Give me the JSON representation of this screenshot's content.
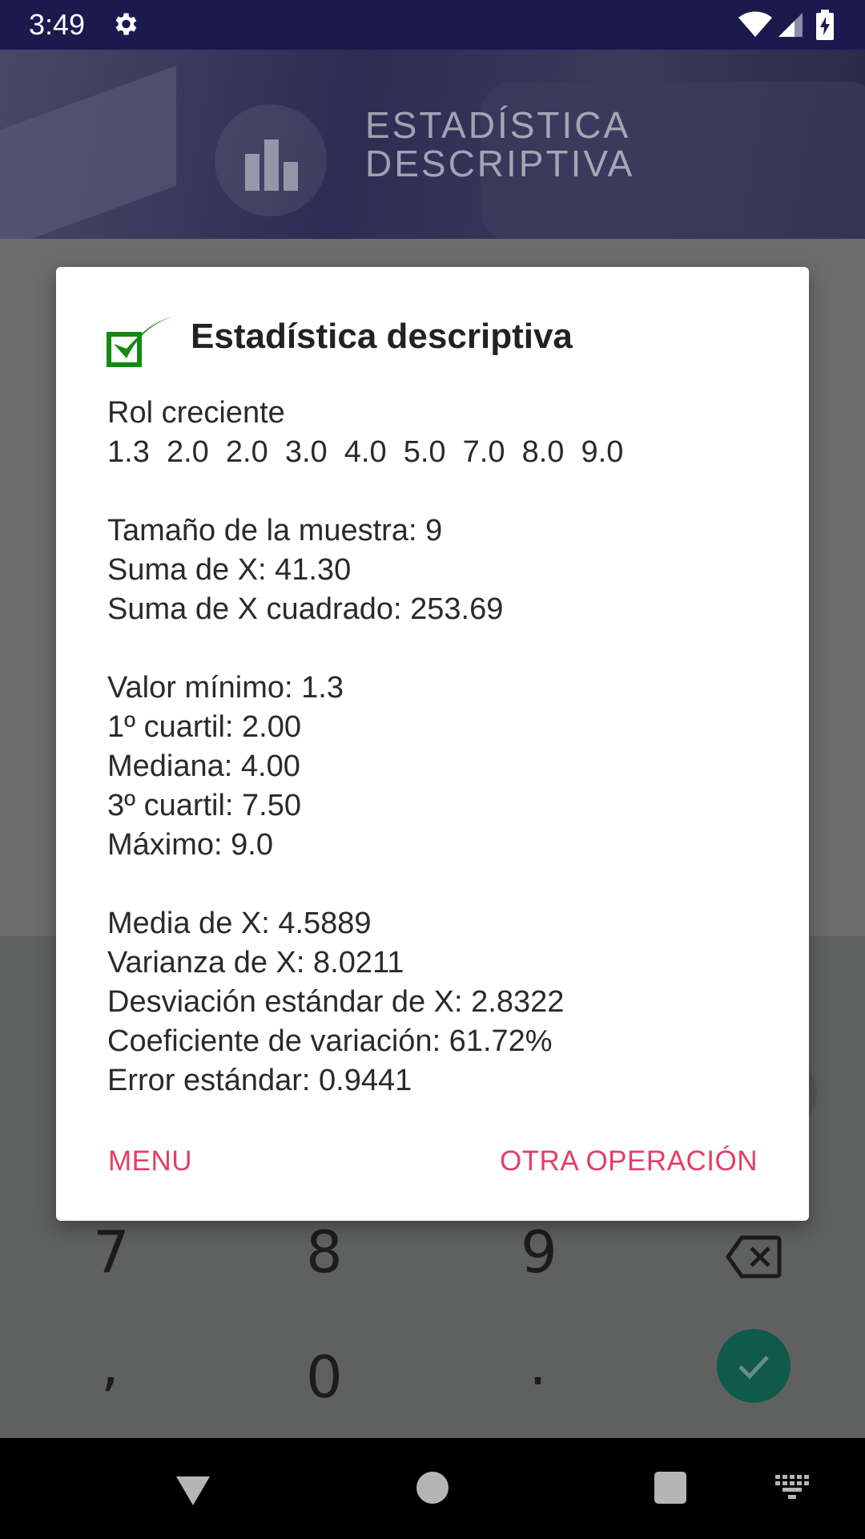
{
  "status_bar": {
    "time": "3:49"
  },
  "banner": {
    "title_line1": "ESTADÍSTICA",
    "title_line2": "DESCRIPTIVA"
  },
  "keypad": {
    "keys": [
      "7",
      "8",
      "9",
      ",",
      "0",
      "."
    ]
  },
  "dialog": {
    "title": "Estadística descriptiva",
    "lines": [
      "Rol creciente",
      "1.3  2.0  2.0  3.0  4.0  5.0  7.0  8.0  9.0",
      "",
      "Tamaño de la muestra: 9",
      "Suma de X: 41.30",
      "Suma de X cuadrado: 253.69",
      "",
      "Valor mínimo: 1.3",
      "1º cuartil: 2.00",
      "Mediana: 4.00",
      "3º cuartil: 7.50",
      "Máximo: 9.0",
      "",
      "Media de X: 4.5889",
      "Varianza de X: 8.0211",
      "Desviación estándar de X: 2.8322",
      "Coeficiente de variación: 61.72%",
      "Error estándar: 0.9441"
    ],
    "buttons": {
      "menu": "MENU",
      "other": "OTRA OPERACIÓN"
    }
  },
  "colors": {
    "accent": "#e23f66",
    "status_bar": "#1b1a4f",
    "check": "#1a8a1a"
  }
}
